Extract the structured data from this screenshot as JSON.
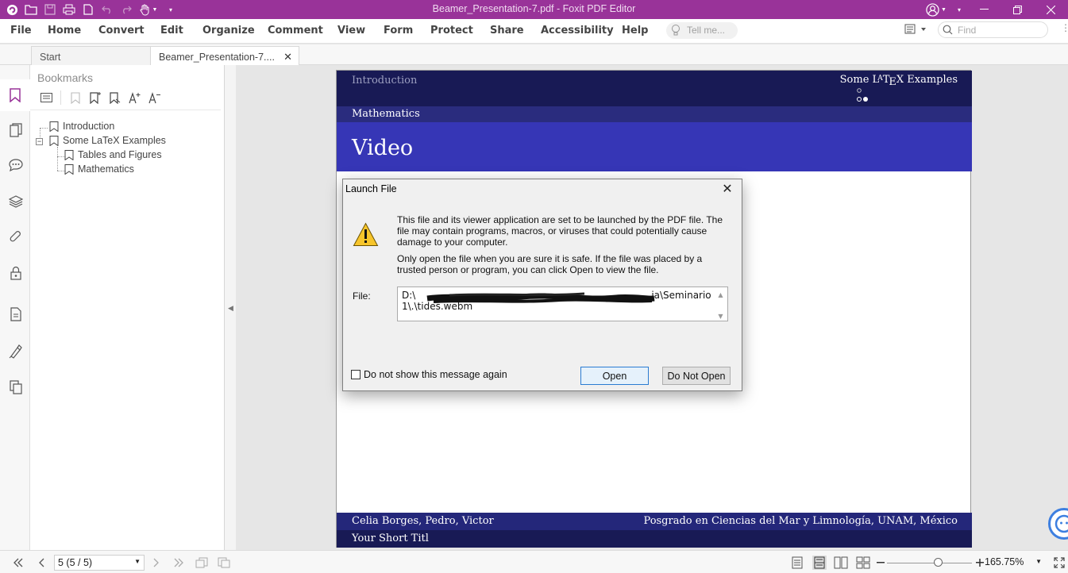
{
  "window": {
    "title": "Beamer_Presentation-7.pdf - Foxit PDF Editor"
  },
  "menu": {
    "items": [
      "File",
      "Home",
      "Convert",
      "Edit",
      "Organize",
      "Comment",
      "View",
      "Form",
      "Protect",
      "Share",
      "Accessibility",
      "Help"
    ],
    "tell_me_placeholder": "Tell me...",
    "find_placeholder": "Find"
  },
  "tabs": [
    {
      "label": "Start"
    },
    {
      "label": "Beamer_Presentation-7...."
    }
  ],
  "bookmarks": {
    "title": "Bookmarks",
    "items": [
      {
        "label": "Introduction"
      },
      {
        "label": "Some LaTeX Examples"
      },
      {
        "label": "Tables and Figures"
      },
      {
        "label": "Mathematics"
      }
    ]
  },
  "slide": {
    "section": "Introduction",
    "subsection_prefix": "Some L",
    "subsection_a": "A",
    "subsection_t": "T",
    "subsection_e": "E",
    "subsection_suffix": "X Examples",
    "band_label": "Mathematics",
    "frame_title": "Video",
    "footer_authors": "Celia Borges, Pedro, Victor",
    "footer_institute": "Posgrado en Ciencias del Mar y Limnología, UNAM, México",
    "footer_short_title": "Your Short Titl"
  },
  "dialog": {
    "title": "Launch File",
    "message1": "This file and its viewer application are set to be launched by the PDF file. The file may contain programs, macros, or viruses that could potentially cause damage to your computer.",
    "message2": "Only open the file when you are sure it is safe. If the file was placed by a trusted person or program, you can click Open to view the file.",
    "file_label": "File:",
    "file_path_line1_start": "D:\\",
    "file_path_line1_end": "ia\\Seminario",
    "file_path_line2": "1\\.\\tides.webm",
    "checkbox_label": "Do not show this message again",
    "checkbox_checked": false,
    "open_label": "Open",
    "do_not_open_label": "Do Not Open"
  },
  "status": {
    "page_indicator": "5 (5 / 5)",
    "zoom": "165.75%",
    "zoom_level": 0.6
  },
  "colors": {
    "titlebar": "#993399",
    "slide_dark": "#181a55",
    "slide_title": "#3636b6",
    "accent_bookmark": "#993399"
  }
}
